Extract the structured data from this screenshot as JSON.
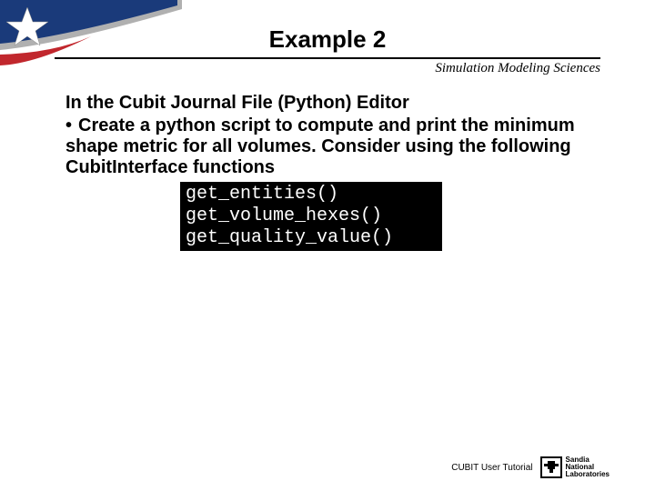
{
  "title": "Example 2",
  "subtitle": "Simulation Modeling Sciences",
  "heading": "In the Cubit Journal File (Python) Editor",
  "bullet": "Create a python script to compute and print the minimum shape metric for all volumes.  Consider using the following CubitInterface functions",
  "code": "get_entities()\nget_volume_hexes()\nget_quality_value()",
  "footer": "CUBIT User Tutorial",
  "logo": {
    "line1": "Sandia",
    "line2": "National",
    "line3": "Laboratories"
  }
}
